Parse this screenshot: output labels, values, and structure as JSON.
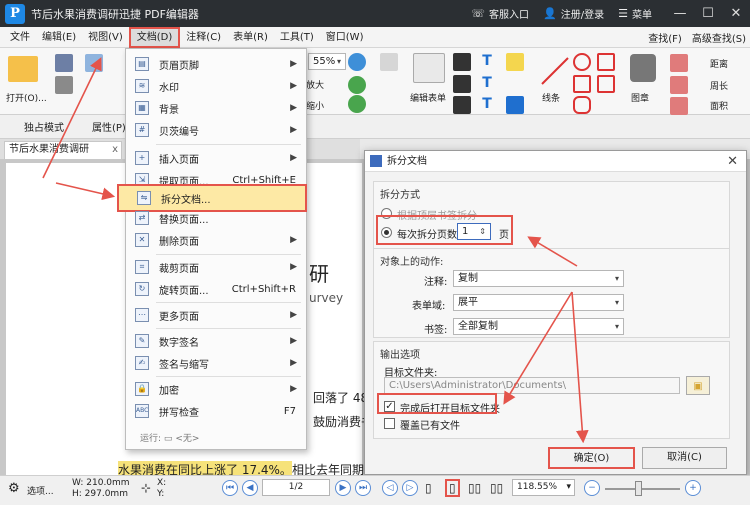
{
  "window": {
    "logo": "P",
    "title": "节后水果消费调研迅捷 PDF编辑器",
    "service": "客服入口",
    "login": "注册/登录",
    "menu_label": "菜单"
  },
  "menubar": {
    "items": [
      "文件",
      "编辑(E)",
      "视图(V)",
      "文档(D)",
      "注释(C)",
      "表单(R)",
      "工具(T)",
      "窗口(W)"
    ],
    "find": "查找(F)",
    "adv_find": "高级查找(S)"
  },
  "ribbon": {
    "open": "打开(O)...",
    "zoom_value": "55%",
    "zoom_in_label": "放大",
    "zoom_out_label": "缩小",
    "edit_form": "编辑表单",
    "line": "线条",
    "stamp": "图章",
    "distance": "距离",
    "perimeter": "周长",
    "area": "面积"
  },
  "subbar": {
    "exclusive": "独占模式",
    "properties": "属性(P)..."
  },
  "doc_tab": {
    "label": "节后水果消费调研",
    "close": "x"
  },
  "document": {
    "line1": "研",
    "line2": "urvey",
    "line3": "回落了  48.9",
    "line4": "鼓励消费书",
    "highlight": "水果消费在同比上涨了 17.4%。",
    "rest": "相比去年同期"
  },
  "doc_menu": {
    "items": [
      {
        "label": "页眉页脚",
        "shortcut": "",
        "submenu": true
      },
      {
        "label": "水印",
        "shortcut": "",
        "submenu": true
      },
      {
        "label": "背景",
        "shortcut": "",
        "submenu": true
      },
      {
        "label": "贝茨编号",
        "shortcut": "",
        "submenu": true
      },
      {
        "label": "插入页面",
        "shortcut": "",
        "submenu": true
      },
      {
        "label": "提取页面...",
        "shortcut": "Ctrl+Shift+E",
        "submenu": false
      },
      {
        "label": "拆分文档...",
        "shortcut": "",
        "submenu": false
      },
      {
        "label": "替换页面...",
        "shortcut": "",
        "submenu": false
      },
      {
        "label": "删除页面",
        "shortcut": "",
        "submenu": true
      },
      {
        "label": "裁剪页面",
        "shortcut": "",
        "submenu": true
      },
      {
        "label": "旋转页面...",
        "shortcut": "Ctrl+Shift+R",
        "submenu": false
      },
      {
        "label": "更多页面",
        "shortcut": "",
        "submenu": true
      },
      {
        "label": "数字签名",
        "shortcut": "",
        "submenu": true
      },
      {
        "label": "签名与缩写",
        "shortcut": "",
        "submenu": true
      },
      {
        "label": "加密",
        "shortcut": "",
        "submenu": true
      },
      {
        "label": "拼写检查",
        "shortcut": "F7",
        "submenu": false
      }
    ],
    "run_label": "运行:",
    "run_value": "<无>"
  },
  "dialog": {
    "title": "拆分文档",
    "split_method": "拆分方式",
    "by_bookmark": "根据顶层书签拆分",
    "per_pages": "每次拆分页数",
    "pages_value": "1",
    "pages_unit": "页",
    "object_actions": "对象上的动作:",
    "notes_label": "注释:",
    "notes_value": "复制",
    "form_label": "表单域:",
    "form_value": "展平",
    "bookmark_label": "书签:",
    "bookmark_value": "全部复制",
    "output": "输出选项",
    "target_folder": "目标文件夹:",
    "folder_path": "C:\\Users\\Administrator\\Documents\\",
    "open_after": "完成后打开目标文件夹",
    "overwrite": "覆盖已有文件",
    "ok": "确定(O)",
    "cancel": "取消(C)"
  },
  "statusbar": {
    "options": "选项...",
    "width": "W: 210.0mm",
    "height": "H: 297.0mm",
    "x": "X:",
    "y": "Y:",
    "page_current": "1",
    "page_total": "/2",
    "zoom": "118.55%"
  },
  "colors": {
    "annotation_red": "#e4544b",
    "menu_highlight": "#fde9a5",
    "titlebar": "#2b2f33"
  }
}
